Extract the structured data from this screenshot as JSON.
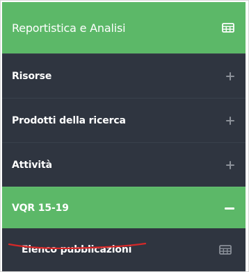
{
  "sidebar": {
    "header": {
      "label": "Reportistica e Analisi",
      "icon": "table-icon"
    },
    "items": [
      {
        "label": "Risorse",
        "icon": "plus-icon"
      },
      {
        "label": "Prodotti della ricerca",
        "icon": "plus-icon"
      },
      {
        "label": "Attività",
        "icon": "plus-icon"
      },
      {
        "label": "VQR 15-19",
        "icon": "minus-icon"
      }
    ],
    "subitems": [
      {
        "label": "Elenco pubblicazioni",
        "icon": "table-icon"
      }
    ]
  },
  "colors": {
    "accent": "#5cb868",
    "background": "#2f3540",
    "text": "#ffffff",
    "annotation": "#d62828"
  }
}
